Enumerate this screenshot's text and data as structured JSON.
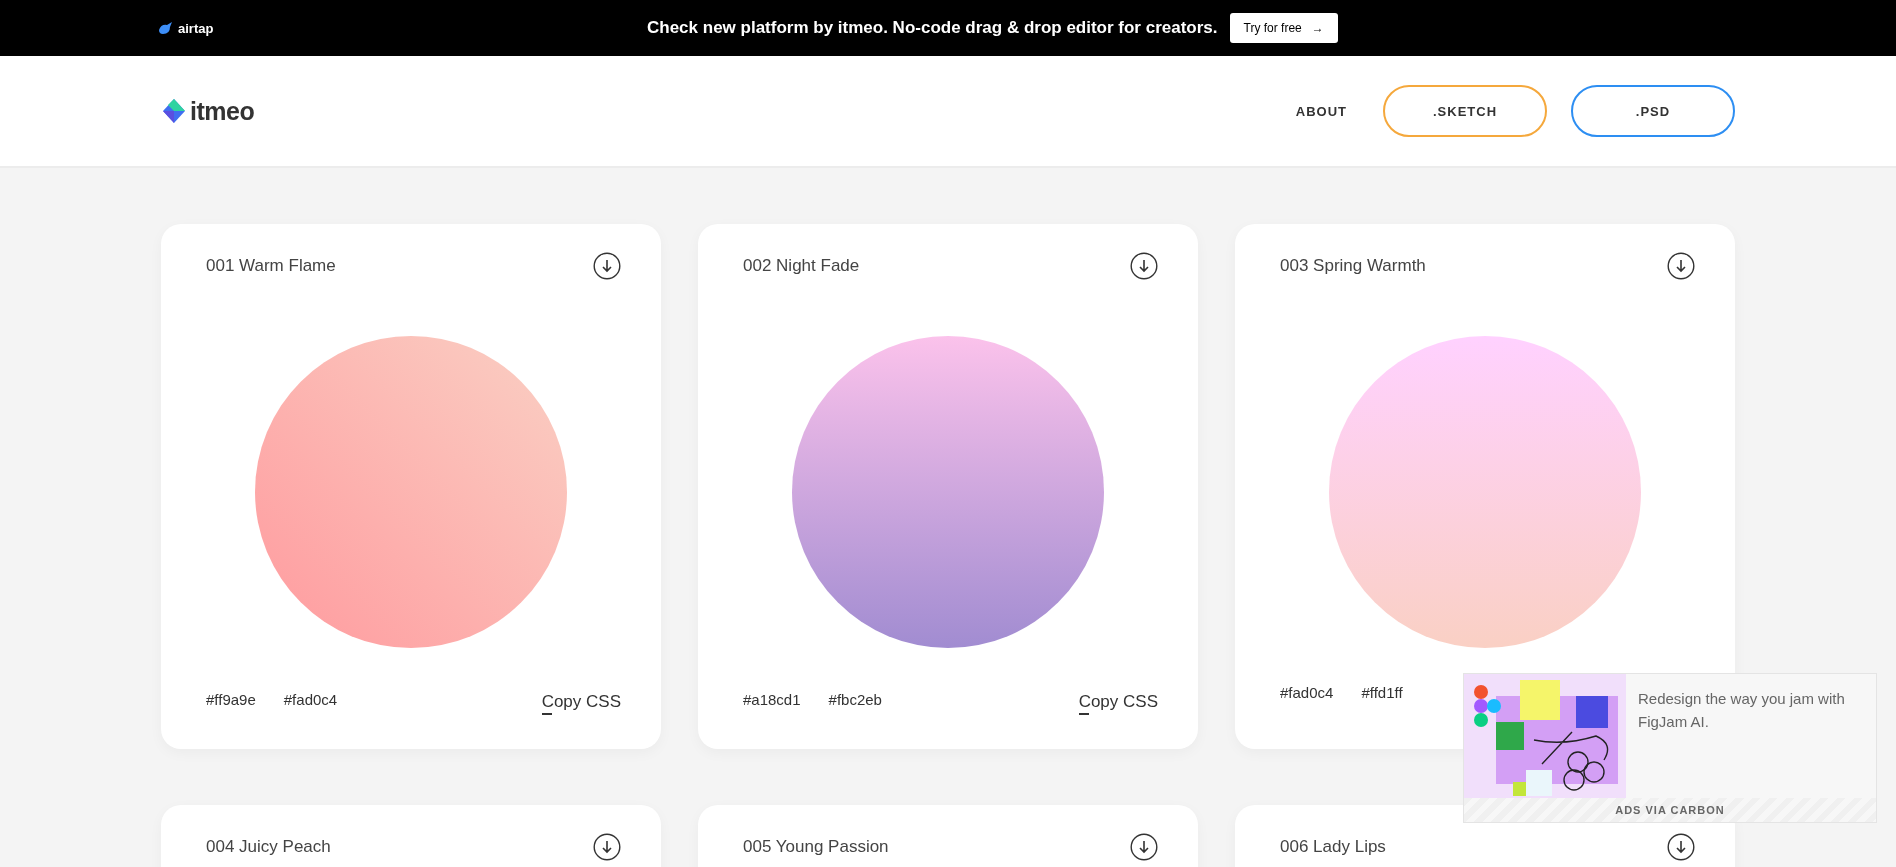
{
  "promo_bar": {
    "brand": "airtap",
    "message": "Check new platform by itmeo. No-code drag & drop editor for creators.",
    "button": "Try for free",
    "button_arrow": "→"
  },
  "header": {
    "brand": "itmeo",
    "nav": [
      {
        "label": "ABOUT",
        "kind": "link"
      },
      {
        "label": ".SKETCH",
        "kind": "outline",
        "color": "#f5a83c"
      },
      {
        "label": ".PSD",
        "kind": "outline",
        "color": "#2d8ef2"
      }
    ]
  },
  "gradients": [
    {
      "title": "001 Warm Flame",
      "kind": "diagonal",
      "codes": [
        "#ff9a9e",
        "#fad0c4"
      ],
      "copy": "Copy CSS"
    },
    {
      "title": "002 Night Fade",
      "kind": "vertical",
      "codes": [
        "#a18cd1",
        "#fbc2eb"
      ],
      "copy": "Copy CSS"
    },
    {
      "title": "003 Spring Warmth",
      "kind": "vertical",
      "codes": [
        "#fad0c4",
        "#ffd1ff"
      ]
    },
    {
      "title": "004 Juicy Peach"
    },
    {
      "title": "005 Young Passion"
    },
    {
      "title": "006 Lady Lips"
    }
  ],
  "ad": {
    "text": "Redesign the way you jam with FigJam AI.",
    "footer": "ADS VIA CARBON"
  }
}
